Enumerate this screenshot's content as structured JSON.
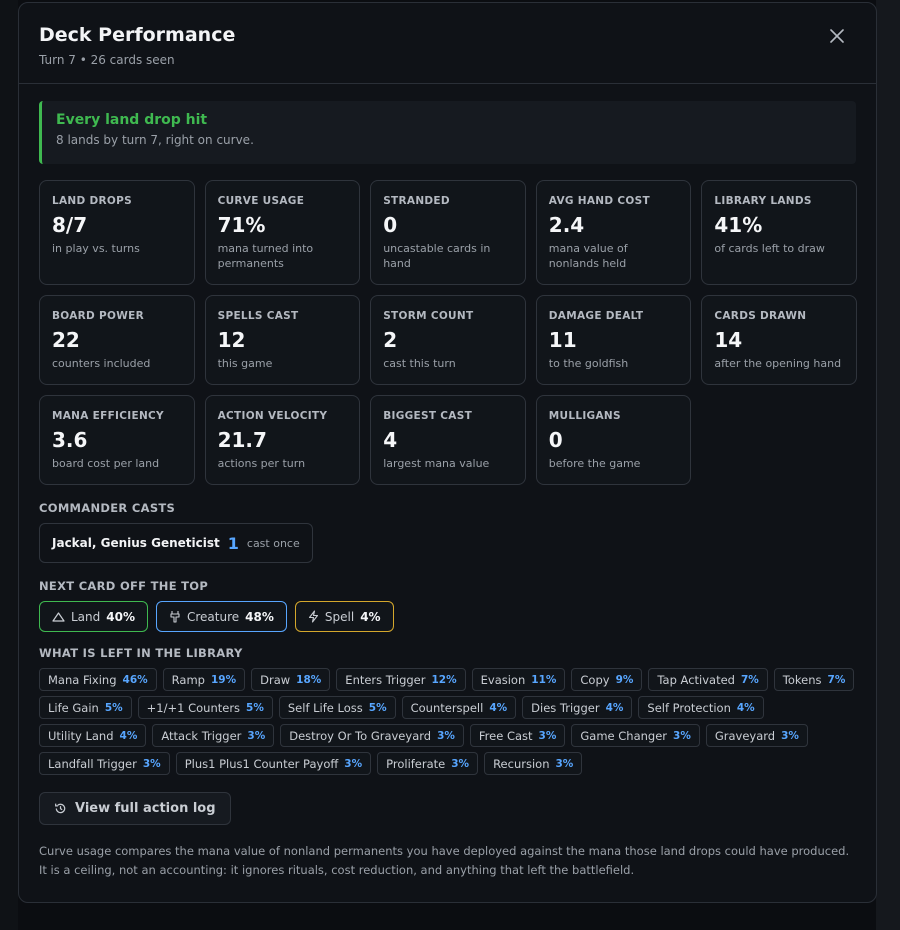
{
  "modal": {
    "title": "Deck Performance",
    "subtitle": "Turn 7 • 26 cards seen",
    "close_icon": "close-icon"
  },
  "banner": {
    "title": "Every land drop hit",
    "text": "8 lands by turn 7, right on curve.",
    "accent_color": "#3fb950"
  },
  "stats": [
    {
      "label": "LAND DROPS",
      "value": "8/7",
      "desc": "in play vs. turns"
    },
    {
      "label": "CURVE USAGE",
      "value": "71%",
      "desc": "mana turned into permanents"
    },
    {
      "label": "STRANDED",
      "value": "0",
      "desc": "uncastable cards in hand"
    },
    {
      "label": "AVG HAND COST",
      "value": "2.4",
      "desc": "mana value of nonlands held"
    },
    {
      "label": "LIBRARY LANDS",
      "value": "41%",
      "desc": "of cards left to draw"
    },
    {
      "label": "BOARD POWER",
      "value": "22",
      "desc": "counters included"
    },
    {
      "label": "SPELLS CAST",
      "value": "12",
      "desc": "this game"
    },
    {
      "label": "STORM COUNT",
      "value": "2",
      "desc": "cast this turn"
    },
    {
      "label": "DAMAGE DEALT",
      "value": "11",
      "desc": "to the goldfish"
    },
    {
      "label": "CARDS DRAWN",
      "value": "14",
      "desc": "after the opening hand"
    },
    {
      "label": "MANA EFFICIENCY",
      "value": "3.6",
      "desc": "board cost per land"
    },
    {
      "label": "ACTION VELOCITY",
      "value": "21.7",
      "desc": "actions per turn"
    },
    {
      "label": "BIGGEST CAST",
      "value": "4",
      "desc": "largest mana value"
    },
    {
      "label": "MULLIGANS",
      "value": "0",
      "desc": "before the game"
    }
  ],
  "commander": {
    "section_label": "COMMANDER CASTS",
    "name": "Jackal, Genius Geneticist",
    "count": "1",
    "note": "cast once"
  },
  "next_card": {
    "section_label": "NEXT CARD OFF THE TOP",
    "chips": [
      {
        "label": "Land",
        "pct": "40%",
        "icon": "mountain-icon",
        "color": "#3fb950"
      },
      {
        "label": "Creature",
        "pct": "48%",
        "icon": "creature-icon",
        "color": "#58a6ff"
      },
      {
        "label": "Spell",
        "pct": "4%",
        "icon": "lightning-icon",
        "color": "#d4a72c"
      }
    ]
  },
  "library": {
    "section_label": "WHAT IS LEFT IN THE LIBRARY",
    "tags": [
      {
        "label": "Mana Fixing",
        "pct": "46%"
      },
      {
        "label": "Ramp",
        "pct": "19%"
      },
      {
        "label": "Draw",
        "pct": "18%"
      },
      {
        "label": "Enters Trigger",
        "pct": "12%"
      },
      {
        "label": "Evasion",
        "pct": "11%"
      },
      {
        "label": "Copy",
        "pct": "9%"
      },
      {
        "label": "Tap Activated",
        "pct": "7%"
      },
      {
        "label": "Tokens",
        "pct": "7%"
      },
      {
        "label": "Life Gain",
        "pct": "5%"
      },
      {
        "label": "+1/+1 Counters",
        "pct": "5%"
      },
      {
        "label": "Self Life Loss",
        "pct": "5%"
      },
      {
        "label": "Counterspell",
        "pct": "4%"
      },
      {
        "label": "Dies Trigger",
        "pct": "4%"
      },
      {
        "label": "Self Protection",
        "pct": "4%"
      },
      {
        "label": "Utility Land",
        "pct": "4%"
      },
      {
        "label": "Attack Trigger",
        "pct": "3%"
      },
      {
        "label": "Destroy Or To Graveyard",
        "pct": "3%"
      },
      {
        "label": "Free Cast",
        "pct": "3%"
      },
      {
        "label": "Game Changer",
        "pct": "3%"
      },
      {
        "label": "Graveyard",
        "pct": "3%"
      },
      {
        "label": "Landfall Trigger",
        "pct": "3%"
      },
      {
        "label": "Plus1 Plus1 Counter Payoff",
        "pct": "3%"
      },
      {
        "label": "Proliferate",
        "pct": "3%"
      },
      {
        "label": "Recursion",
        "pct": "3%"
      }
    ]
  },
  "action_log_button": {
    "label": "View full action log",
    "icon": "history-icon"
  },
  "footnote": "Curve usage compares the mana value of nonland permanents you have deployed against the mana those land drops could have produced. It is a ceiling, not an accounting: it ignores rituals, cost reduction, and anything that left the battlefield."
}
